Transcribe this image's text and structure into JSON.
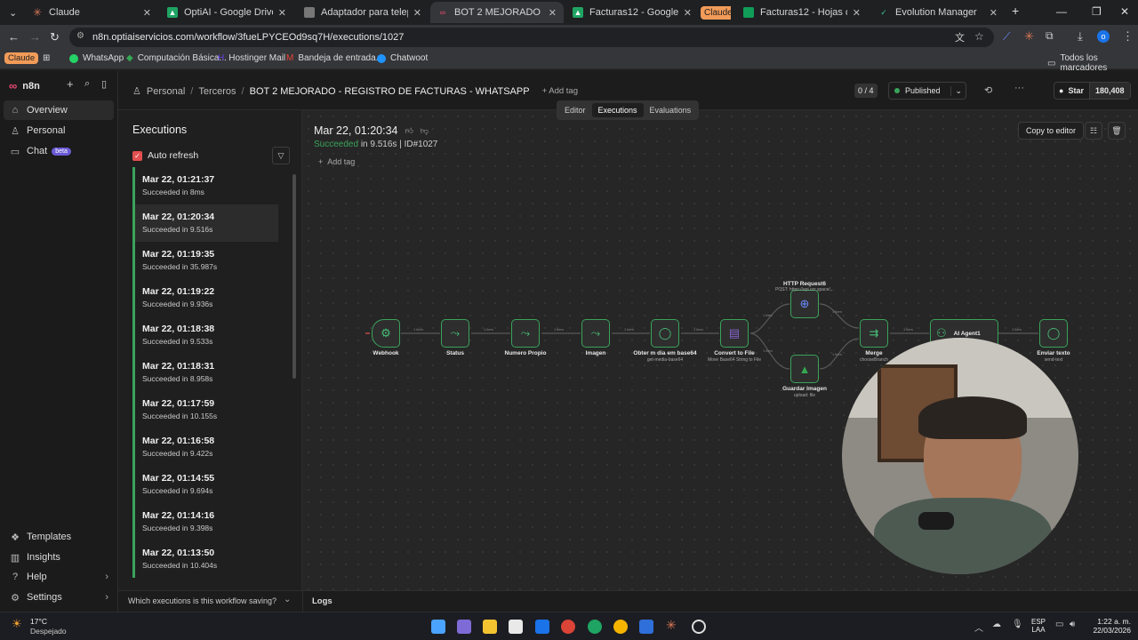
{
  "browser": {
    "tabs": [
      {
        "title": "Claude",
        "icon": "claude-icon",
        "color": "#d97757"
      },
      {
        "title": "OptiAI - Google Drive",
        "icon": "drive-icon",
        "color": "#1fa463"
      },
      {
        "title": "Adaptador para teleprompter",
        "icon": "teleprompter-icon",
        "color": "#888888"
      },
      {
        "title": "BOT 2 MEJORADO - REGIS",
        "icon": "n8n-icon",
        "color": "#ea4b71"
      },
      {
        "title": "Facturas12 - Google Drive",
        "icon": "drive-icon",
        "color": "#1fa463"
      },
      {
        "title": "Facturas12 - Hojas de cálculo",
        "icon": "sheets-icon",
        "color": "#0f9d58"
      },
      {
        "title": "Evolution Manager",
        "icon": "evolution-icon",
        "color": "#3ec28f"
      }
    ],
    "group_label": "Claude",
    "url": "n8n.optiaiservicios.com/workflow/3fueLPYCEOd9sq7H/executions/1027",
    "bookmarks": [
      {
        "label": "Claude"
      },
      {
        "label": "WhatsApp"
      },
      {
        "label": "Computación Básica..."
      },
      {
        "label": "Hostinger Mail"
      },
      {
        "label": "Bandeja de entrada..."
      },
      {
        "label": "Chatwoot"
      }
    ],
    "all_bookmarks": "Todos los marcadores"
  },
  "sidebar": {
    "brand": "n8n",
    "items": [
      {
        "label": "Overview"
      },
      {
        "label": "Personal"
      },
      {
        "label": "Chat",
        "badge": "beta"
      }
    ],
    "bottom": [
      {
        "label": "Templates"
      },
      {
        "label": "Insights"
      },
      {
        "label": "Help"
      },
      {
        "label": "Settings"
      }
    ]
  },
  "header": {
    "crumb1": "Personal",
    "crumb2": "Terceros",
    "title": "BOT 2 MEJORADO - REGISTRO DE FACTURAS - WHATSAPP",
    "add_tag": "+ Add tag",
    "counter": "0 / 4",
    "status": "Published",
    "star": "Star",
    "star_count": "180,408",
    "tabs": [
      "Editor",
      "Executions",
      "Evaluations"
    ]
  },
  "executions": {
    "title": "Executions",
    "auto_refresh": "Auto refresh",
    "items": [
      {
        "time": "Mar 22, 01:21:37",
        "status": "Succeeded in 8ms"
      },
      {
        "time": "Mar 22, 01:20:34",
        "status": "Succeeded in 9.516s"
      },
      {
        "time": "Mar 22, 01:19:35",
        "status": "Succeeded in 35.987s"
      },
      {
        "time": "Mar 22, 01:19:22",
        "status": "Succeeded in 9.936s"
      },
      {
        "time": "Mar 22, 01:18:38",
        "status": "Succeeded in 9.533s"
      },
      {
        "time": "Mar 22, 01:18:31",
        "status": "Succeeded in 8.958s"
      },
      {
        "time": "Mar 22, 01:17:59",
        "status": "Succeeded in 10.155s"
      },
      {
        "time": "Mar 22, 01:16:58",
        "status": "Succeeded in 9.422s"
      },
      {
        "time": "Mar 22, 01:14:55",
        "status": "Succeeded in 9.694s"
      },
      {
        "time": "Mar 22, 01:14:16",
        "status": "Succeeded in 9.398s"
      },
      {
        "time": "Mar 22, 01:13:50",
        "status": "Succeeded in 10.404s"
      }
    ],
    "footer_question": "Which executions is this workflow saving?"
  },
  "detail": {
    "time": "Mar 22, 01:20:34",
    "status_word": "Succeeded",
    "status_rest": " in 9.516s | ID#1027",
    "add_tag": "Add tag",
    "copy_to_editor": "Copy to editor"
  },
  "workflow": {
    "nodes": [
      {
        "label": "Webhook",
        "sub": ""
      },
      {
        "label": "Status",
        "sub": ""
      },
      {
        "label": "Numero Propio",
        "sub": ""
      },
      {
        "label": "Imagen",
        "sub": ""
      },
      {
        "label": "Obter m dia em base64",
        "sub": "get-media-base64"
      },
      {
        "label": "Convert to File",
        "sub": "Move Base64 String to File"
      },
      {
        "label": "HTTP Request6",
        "sub": "POST: https://api.ocr.space/..."
      },
      {
        "label": "Guardar Imagen",
        "sub": "upload: file"
      },
      {
        "label": "Merge",
        "sub": "chooseBranch"
      },
      {
        "label": "AI Agent1",
        "sub": ""
      },
      {
        "label": "Enviar texto",
        "sub": "send-text"
      }
    ],
    "edge_label": "1 item"
  },
  "bottom": {
    "logs": "Logs"
  },
  "taskbar": {
    "weather_temp": "17°C",
    "weather_desc": "Despejado",
    "lang": "ESP",
    "lang2": "LAA",
    "time": "1:22 a. m.",
    "date": "22/03/2026"
  },
  "colors": {
    "accent_green": "#3aa35a",
    "brand": "#ea4b71"
  }
}
